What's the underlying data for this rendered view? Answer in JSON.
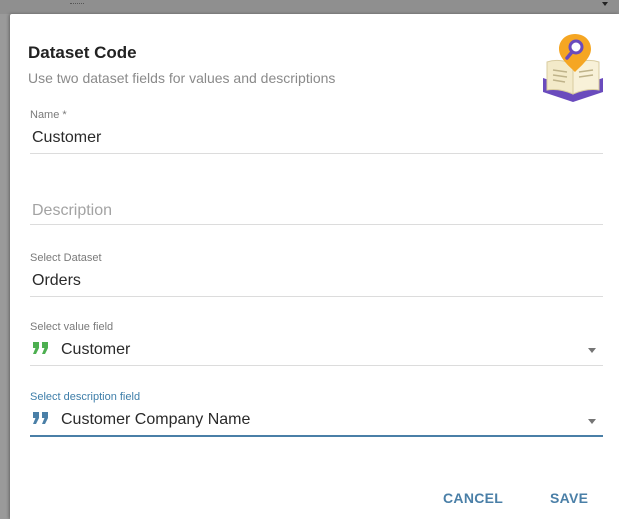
{
  "dialog": {
    "title": "Dataset Code",
    "subtitle": "Use two dataset fields for values and descriptions",
    "header_icon": "book-search-icon"
  },
  "fields": {
    "name": {
      "label": "Name *",
      "value": "Customer"
    },
    "description": {
      "placeholder": "Description",
      "value": ""
    },
    "dataset": {
      "label": "Select Dataset",
      "value": "Orders"
    },
    "value_field": {
      "label": "Select value field",
      "value": "Customer",
      "icon": "quote-icon"
    },
    "description_field": {
      "label": "Select description field",
      "value": "Customer Company Name",
      "icon": "quote-icon"
    }
  },
  "actions": {
    "cancel_label": "CANCEL",
    "save_label": "SAVE"
  },
  "colors": {
    "accent": "#4a7fa7",
    "quote_green": "#4caf50",
    "book_purple": "#6a4bbd",
    "magnifier_orange": "#f5a623"
  }
}
